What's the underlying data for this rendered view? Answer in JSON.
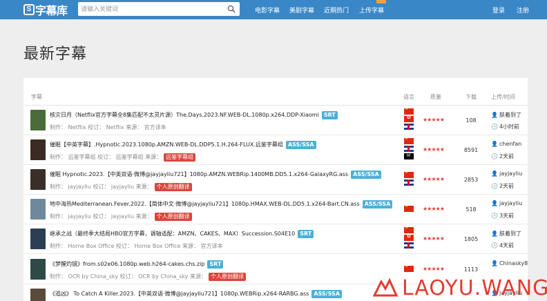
{
  "nav": {
    "logo_text": "字幕库",
    "search_placeholder": "请输入关键词",
    "links": [
      "电影字幕",
      "美剧字幕",
      "近期热门",
      "上传字幕"
    ],
    "login": "登录",
    "register": "注册"
  },
  "page_title": "最新字幕",
  "table": {
    "headers": {
      "subtitle": "字幕",
      "language": "语言",
      "quality": "质量",
      "downloads": "下载",
      "upload": "上传/时间"
    },
    "rows": [
      {
        "title": "核灾日月（Netflix官方字幕全8集匹配不太灵片源）The.Days.2023.NF.WEB-DL.1080p.x264.DDP-Xiaomi",
        "tag": "SRT",
        "meta": "制作： Netflix  校订： Netflix  来源： 官方译本",
        "orig": "",
        "flags": [
          "cn",
          "hk",
          "gb"
        ],
        "stars": "★★★★★",
        "downloads": "108",
        "uploader": "肤着到了",
        "time": "4小时前",
        "thumb_color": "#4a6b3a"
      },
      {
        "title": "催眠【中英字幕】.Hypnotic.2023.1080p.AMZN.WEB-DL.DDP5.1.H.264-FLUX.远鉴字幕组",
        "tag": "ASS/SSA",
        "meta": "制作： 远鉴字幕组  校订： 远鉴字幕组  来源：",
        "orig": "远鉴字幕组",
        "flags": [
          "cn",
          "gb",
          "pi"
        ],
        "stars": "★★★★★",
        "downloads": "8591",
        "uploader": "chenfan",
        "time": "2天前",
        "thumb_color": "#3b2b22"
      },
      {
        "title": "催眠 Hypnotic.2023.【中英双语·微博@jayjayliu721】1080p.AMZN.WEBRip.1400MB.DD5.1.x264-GalaxyRG.ass",
        "tag": "ASS/SSA",
        "meta": "制作： jayjayliu  校订： jayjayliu  来源：",
        "orig": "个人原创翻译",
        "flags": [
          "cn",
          "gb"
        ],
        "stars": "★★★★★",
        "downloads": "2853",
        "uploader": "jayjayliu",
        "time": "2天前",
        "thumb_color": "#3a2e2a"
      },
      {
        "title": "地中海热Mediterranean.Fever.2022.【简体中文·微博@jayjayliu721】1080p.HMAX.WEB-DL.DD5.1.x264-Bart.CN.ass",
        "tag": "ASS/SSA",
        "meta": "制作： jayjayliu  校订： jayjayliu  来源：",
        "orig": "个人原创翻译",
        "flags": [
          "cn"
        ],
        "stars": "★★★★★",
        "downloads": "518",
        "uploader": "jayjayliu",
        "time": "3天前",
        "thumb_color": "#6e8a9a"
      },
      {
        "title": "继承之战（最终季大结局HBO官方字幕，调轴适配：AMZN、CAKES、MAX）Succession.S04E10",
        "tag": "SRT",
        "meta": "制作： Home Box Office  校订： Home Box Office  来源： 官方译本",
        "orig": "",
        "flags": [
          "cn",
          "hk",
          "gb"
        ],
        "stars": "★★★★★",
        "downloads": "1805",
        "uploader": "肤着到了",
        "time": "4天前",
        "thumb_color": "#2c3e55"
      },
      {
        "title": "《梦醒灼镜》from.s02e06.1080p.web.h264-cakes.chs.zip",
        "tag": "SRT",
        "meta": "制作： OCR by China_sky  校订： OCR by China_sky  来源：",
        "orig": "个人原创翻译",
        "flags": [
          "cn"
        ],
        "stars": "★★★★★",
        "downloads": "1113",
        "uploader": "Chinasky8",
        "time": "",
        "thumb_color": "#2e4a46"
      },
      {
        "title": "《追凶》 To Catch A Killer.2023.【中英双语·微博@jayjayliu721】1080p.WEBRip.x264-RARBG.ass",
        "tag": "ASS/SSA",
        "meta": "",
        "orig": "",
        "flags": [],
        "stars": "",
        "downloads": "",
        "uploader": "jayjayliu",
        "time": "",
        "thumb_color": "#5a4a3a"
      }
    ]
  },
  "watermark": "LAOYU.WANG"
}
